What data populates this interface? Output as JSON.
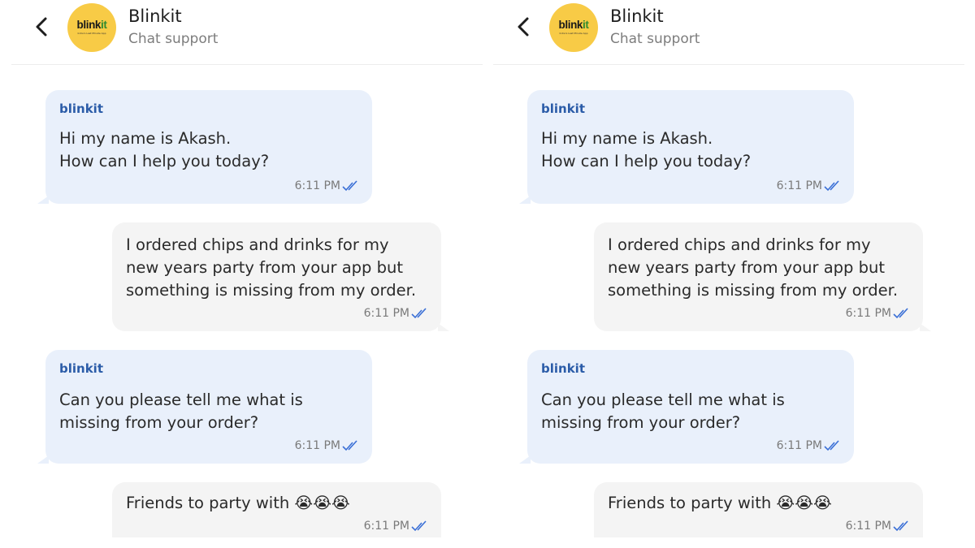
{
  "colors": {
    "incoming_bubble": "#e9f0fb",
    "outgoing_bubble": "#f4f4f4",
    "sender_name": "#2b5ca8",
    "read_ticks": "#3a6fd6",
    "logo_yellow": "#f8cb46"
  },
  "header": {
    "title": "Blinkit",
    "subtitle": "Chat support",
    "logo_text_main": "blink",
    "logo_text_accent": "it",
    "logo_tagline": "India's Last Minute App",
    "back_icon": "chevron-left-icon"
  },
  "messages": [
    {
      "direction": "incoming",
      "sender": "blinkit",
      "lines": [
        "Hi my name is Akash.",
        "How can I help you today?"
      ],
      "time": "6:11 PM",
      "status": "read"
    },
    {
      "direction": "outgoing",
      "lines": [
        "I ordered chips and drinks for my",
        "new years party from your app but",
        "something is missing from my order."
      ],
      "time": "6:11 PM",
      "status": "read"
    },
    {
      "direction": "incoming",
      "sender": "blinkit",
      "lines": [
        "Can you please tell me what is",
        "missing from your order?"
      ],
      "time": "6:11 PM",
      "status": "read"
    },
    {
      "direction": "outgoing",
      "lines": [
        "Friends to party with"
      ],
      "emoji": "😭😭😭",
      "time": "6:11 PM",
      "status": "read"
    }
  ]
}
